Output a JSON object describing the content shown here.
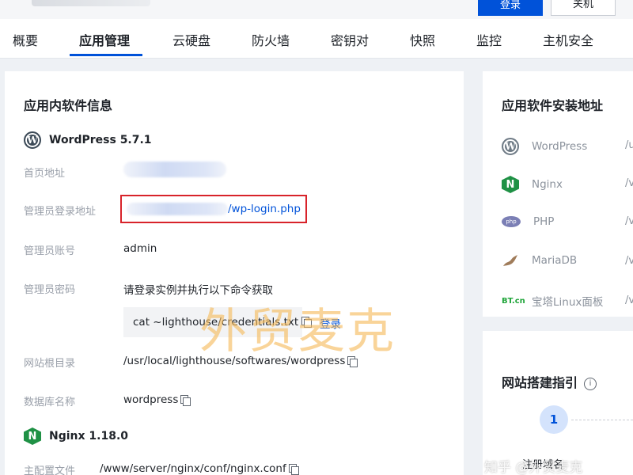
{
  "header": {
    "primary_button": "登录",
    "secondary_button": "关机"
  },
  "tabs": [
    {
      "label": "概要"
    },
    {
      "label": "应用管理",
      "active": true
    },
    {
      "label": "云硬盘"
    },
    {
      "label": "防火墙"
    },
    {
      "label": "密钥对"
    },
    {
      "label": "快照"
    },
    {
      "label": "监控"
    },
    {
      "label": "主机安全"
    }
  ],
  "app_info": {
    "title": "应用内软件信息",
    "wordpress": {
      "name": "WordPress 5.7.1",
      "rows": {
        "home_url": {
          "label": "首页地址"
        },
        "admin_login": {
          "label": "管理员登录地址",
          "value": "/wp-login.php"
        },
        "admin_account": {
          "label": "管理员账号",
          "value": "admin"
        },
        "admin_password": {
          "label": "管理员密码",
          "hint": "请登录实例并执行以下命令获取",
          "command": "cat ~lighthouse/credentials.txt",
          "login_link": "登录"
        },
        "site_root": {
          "label": "网站根目录",
          "value": "/usr/local/lighthouse/softwares/wordpress"
        },
        "db_name": {
          "label": "数据库名称",
          "value": "wordpress"
        }
      }
    },
    "nginx": {
      "name": "Nginx 1.18.0",
      "config": {
        "label": "主配置文件",
        "value": "/www/server/nginx/conf/nginx.conf"
      }
    }
  },
  "watermark": "外贸麦克",
  "install_paths": {
    "title": "应用软件安装地址",
    "items": [
      {
        "name": "WordPress",
        "path": "/u",
        "icon": "wordpress-icon"
      },
      {
        "name": "Nginx",
        "path": "/v",
        "icon": "nginx-icon"
      },
      {
        "name": "PHP",
        "path": "/v",
        "icon": "php-icon"
      },
      {
        "name": "MariaDB",
        "path": "/v",
        "icon": "mariadb-icon"
      },
      {
        "name": "宝塔Linux面板",
        "path": "/v",
        "icon": "bt-panel-icon"
      }
    ]
  },
  "site_guide": {
    "title": "网站搭建指引",
    "step_number": "1",
    "step_label": "注册域名"
  },
  "zhihu_watermark": "知乎 @外贸麦克",
  "colors": {
    "accent": "#0052d9",
    "highlight_border": "#d8232a",
    "nginx_green": "#1f9145",
    "bt_green": "#20a53a"
  }
}
